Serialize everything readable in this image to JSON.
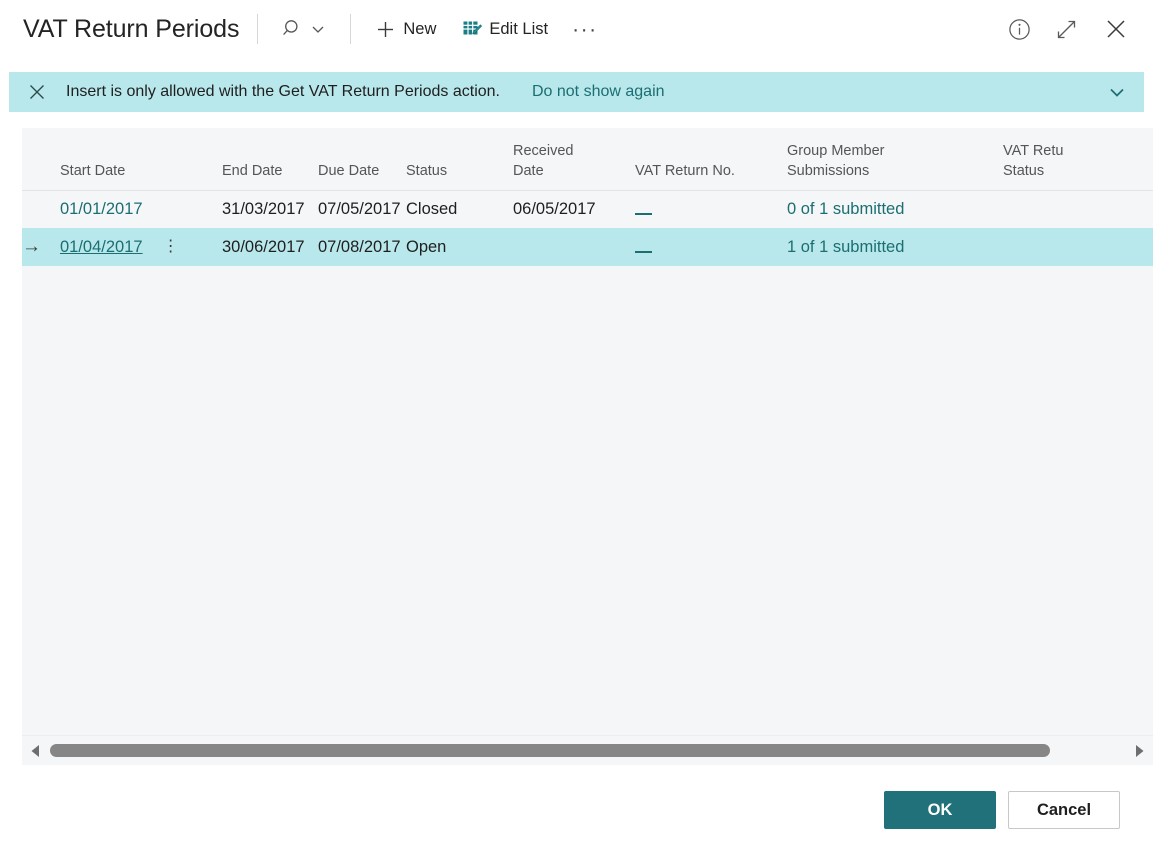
{
  "header": {
    "title": "VAT Return Periods",
    "search_icon": "search-icon",
    "search_chevron_icon": "chevron-down-icon",
    "new_label": "New",
    "new_icon": "plus-icon",
    "edit_list_label": "Edit List",
    "edit_list_icon": "edit-list-icon",
    "more_label": "···",
    "info_icon": "info-icon",
    "expand_icon": "expand-icon",
    "close_icon": "close-icon"
  },
  "notification": {
    "close_icon": "close-icon",
    "message": "Insert is only allowed with the Get VAT Return Periods action.",
    "dismiss_link": "Do not show again",
    "chevron_icon": "chevron-down-icon"
  },
  "grid": {
    "columns": [
      {
        "key": "indicator",
        "label": ""
      },
      {
        "key": "start_date",
        "label": "Start Date"
      },
      {
        "key": "end_date",
        "label": "End Date"
      },
      {
        "key": "due_date",
        "label": "Due Date"
      },
      {
        "key": "status",
        "label": "Status"
      },
      {
        "key": "received_date",
        "label": "Received\nDate"
      },
      {
        "key": "vat_return_no",
        "label": "VAT Return No."
      },
      {
        "key": "group_member_submissions",
        "label": "Group Member\nSubmissions"
      },
      {
        "key": "vat_return_status",
        "label": "VAT Retu\nStatus"
      }
    ],
    "rows": [
      {
        "selected": false,
        "start_date": "01/01/2017",
        "end_date": "31/03/2017",
        "due_date": "07/05/2017",
        "status": "Closed",
        "received_date": "06/05/2017",
        "vat_return_no": "",
        "group_member_submissions": "0 of 1 submitted",
        "vat_return_status": ""
      },
      {
        "selected": true,
        "row_indicator": "→",
        "row_menu_icon": "vertical-dots-icon",
        "start_date": "01/04/2017",
        "end_date": "30/06/2017",
        "due_date": "07/08/2017",
        "status": "Open",
        "received_date": "",
        "vat_return_no": "",
        "group_member_submissions": "1 of 1 submitted",
        "vat_return_status": ""
      }
    ]
  },
  "scrollbar": {
    "left_arrow_icon": "caret-left-icon",
    "right_arrow_icon": "caret-right-icon"
  },
  "footer": {
    "ok_label": "OK",
    "cancel_label": "Cancel"
  },
  "colors": {
    "accent_teal": "#20717a",
    "notification_bg": "#b8e8ec",
    "selected_row_bg": "#b8e8ec",
    "link_teal": "#1b6e72",
    "grid_bg": "#f5f6f7"
  }
}
